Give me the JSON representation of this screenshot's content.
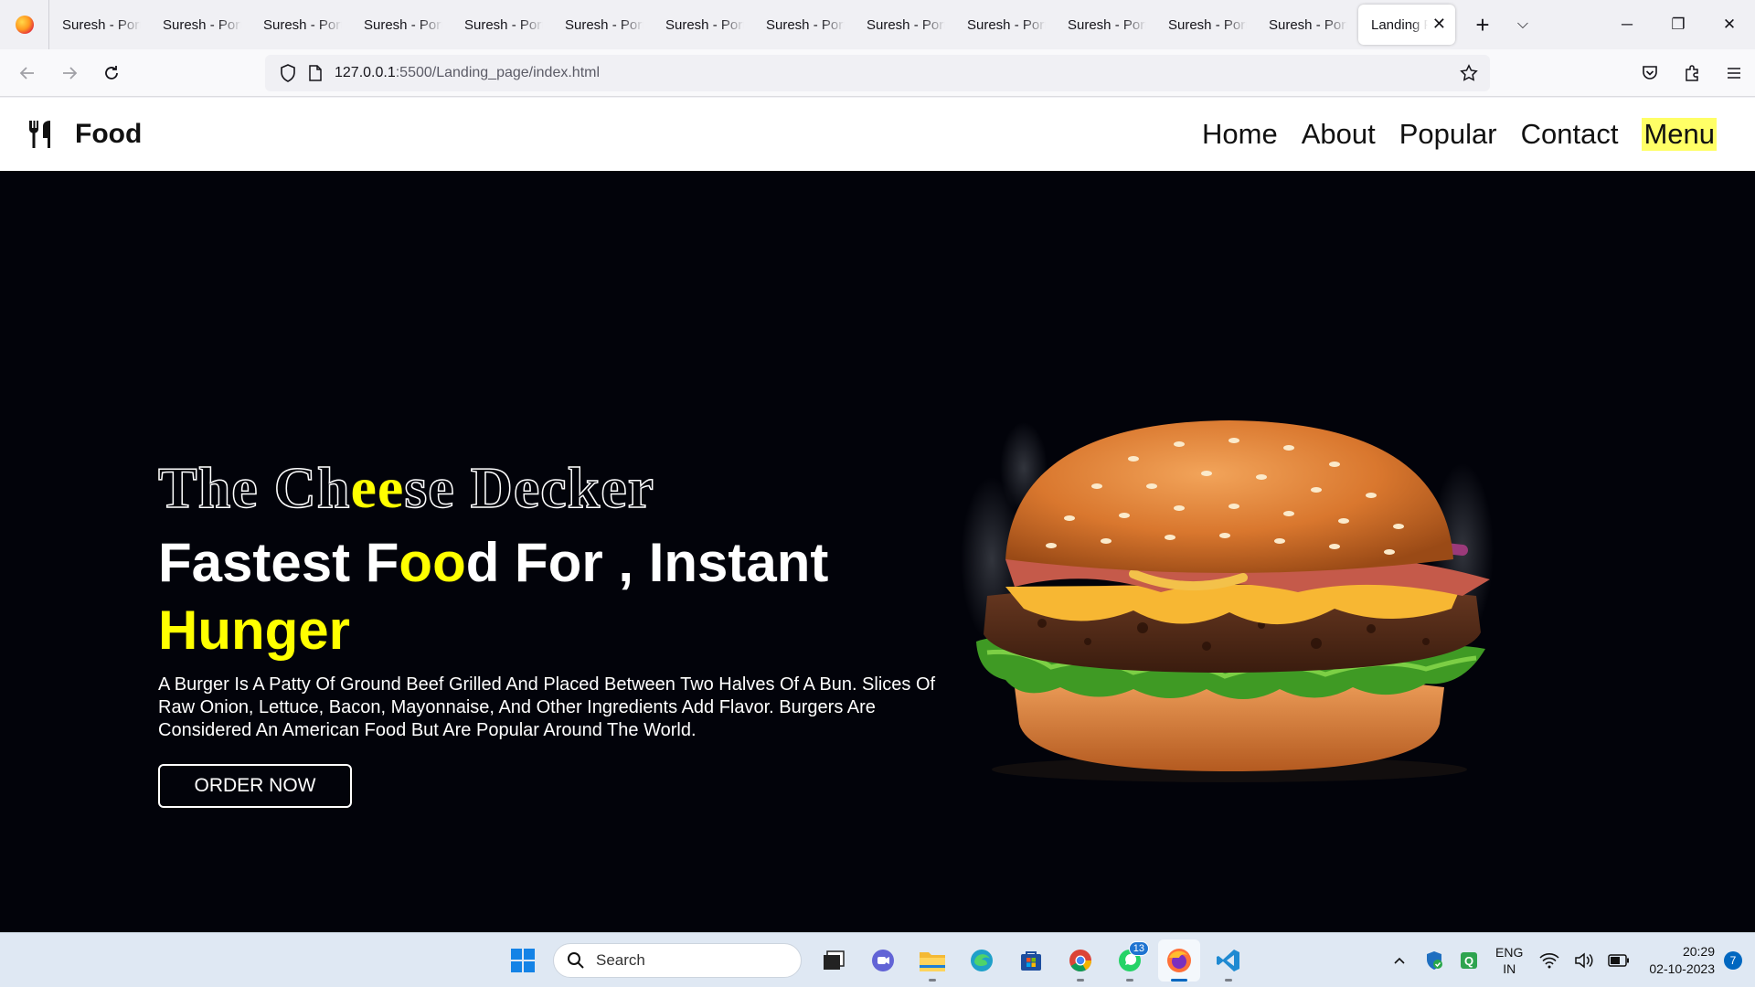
{
  "browser": {
    "tabs": [
      {
        "label": "Suresh - Portfolio"
      },
      {
        "label": "Suresh - Portfolio"
      },
      {
        "label": "Suresh - Portfolio"
      },
      {
        "label": "Suresh - Portfolio"
      },
      {
        "label": "Suresh - Portfolio"
      },
      {
        "label": "Suresh - Portfolio"
      },
      {
        "label": "Suresh - Portfolio"
      },
      {
        "label": "Suresh - Portfolio"
      },
      {
        "label": "Suresh - Portfolio"
      },
      {
        "label": "Suresh - Portfolio"
      },
      {
        "label": "Suresh - Portfolio"
      },
      {
        "label": "Suresh - Portfolio"
      },
      {
        "label": "Suresh - Portfolio"
      }
    ],
    "active_tab": {
      "label": "Landing Page"
    },
    "url_host": "127.0.0.1",
    "url_rest": ":5500/Landing_page/index.html"
  },
  "site": {
    "brand": "Food",
    "menu": [
      {
        "label": "Home"
      },
      {
        "label": "About"
      },
      {
        "label": "Popular"
      },
      {
        "label": "Contact"
      },
      {
        "label": "Menu",
        "highlighted": true
      }
    ]
  },
  "hero": {
    "title_parts": [
      "The Ch",
      "ee",
      "se Decker"
    ],
    "headline_parts": [
      "Fastest F",
      "oo",
      "d For , Instant"
    ],
    "headline_highlight": "Hunger",
    "description": "A Burger Is A Patty Of Ground Beef Grilled And Placed Between Two Halves Of A Bun. Slices Of Raw Onion, Lettuce, Bacon, Mayonnaise, And Other Ingredients Add Flavor. Burgers Are Considered An American Food But Are Popular Around The World.",
    "cta": "ORDER NOW"
  },
  "taskbar": {
    "search_label": "Search",
    "whatsapp_badge": "13",
    "lang_line1": "ENG",
    "lang_line2": "IN",
    "time": "20:29",
    "date": "02-10-2023",
    "notifications": "7"
  },
  "colors": {
    "accent_yellow": "#ffff00",
    "page_bg": "#02030a",
    "menu_highlight": "#ffff66"
  }
}
